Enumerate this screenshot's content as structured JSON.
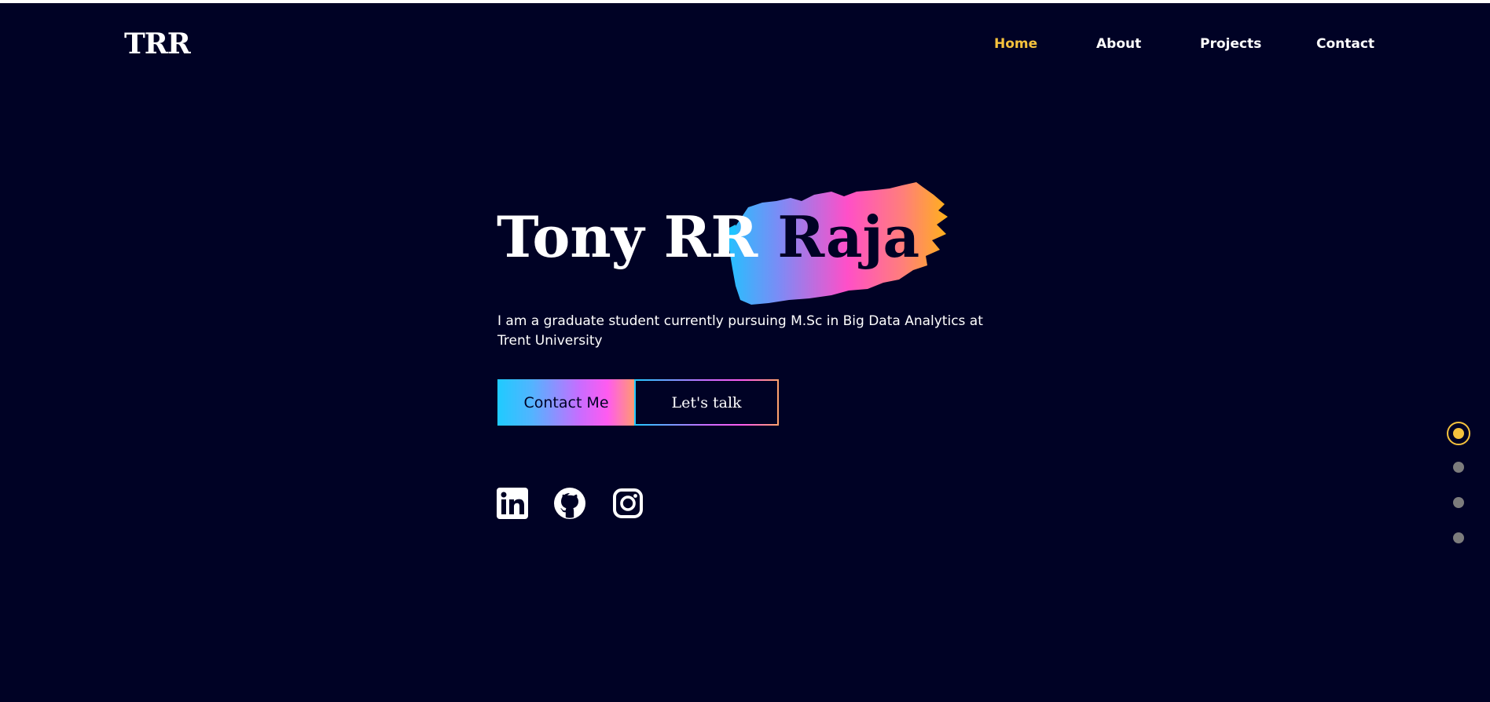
{
  "brand": {
    "logo_text": "TRR"
  },
  "nav": {
    "items": [
      {
        "label": "Home",
        "active": true
      },
      {
        "label": "About",
        "active": false
      },
      {
        "label": "Projects",
        "active": false
      },
      {
        "label": "Contact",
        "active": false
      }
    ]
  },
  "hero": {
    "first_name": "Tony RR ",
    "last_name": "Raja",
    "intro": "I am a graduate student currently pursuing M.Sc in Big Data Analytics at Trent University"
  },
  "buttons": {
    "contact_label": "Contact Me",
    "talk_label": "Let's talk"
  },
  "social": [
    {
      "icon": "linkedin-icon"
    },
    {
      "icon": "github-icon"
    },
    {
      "icon": "instagram-icon"
    }
  ],
  "section_dots": {
    "count": 4,
    "active_index": 0
  },
  "colors": {
    "background": "#000225",
    "accent": "#f5c23d",
    "text": "#ffffff",
    "inactive_dot": "#7c7c7c",
    "gradient": [
      "#1fcbff",
      "#ff5bf0",
      "#ffa21f"
    ]
  }
}
